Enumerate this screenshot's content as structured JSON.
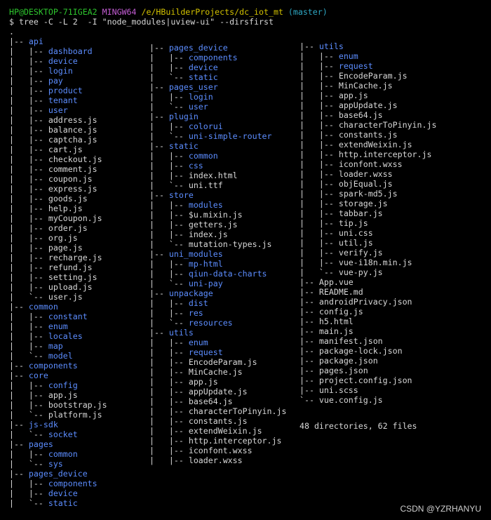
{
  "prompt": {
    "user_host": "HP@DESKTOP-71IGEA2",
    "system": "MINGW64",
    "path": "/e/HBuilderProjects/dc_iot_mt",
    "branch": "(master)"
  },
  "command": "$ tree -C -L 2  -I \"node_modules|uview-ui\" --dirsfirst",
  "columns": [
    [
      {
        "p": ".",
        "n": "",
        "t": "dir"
      },
      {
        "p": "|-- ",
        "n": "api",
        "t": "dir"
      },
      {
        "p": "|   |-- ",
        "n": "dashboard",
        "t": "dir"
      },
      {
        "p": "|   |-- ",
        "n": "device",
        "t": "dir"
      },
      {
        "p": "|   |-- ",
        "n": "login",
        "t": "dir"
      },
      {
        "p": "|   |-- ",
        "n": "pay",
        "t": "dir"
      },
      {
        "p": "|   |-- ",
        "n": "product",
        "t": "dir"
      },
      {
        "p": "|   |-- ",
        "n": "tenant",
        "t": "dir"
      },
      {
        "p": "|   |-- ",
        "n": "user",
        "t": "dir"
      },
      {
        "p": "|   |-- ",
        "n": "address.js",
        "t": "file"
      },
      {
        "p": "|   |-- ",
        "n": "balance.js",
        "t": "file"
      },
      {
        "p": "|   |-- ",
        "n": "captcha.js",
        "t": "file"
      },
      {
        "p": "|   |-- ",
        "n": "cart.js",
        "t": "file"
      },
      {
        "p": "|   |-- ",
        "n": "checkout.js",
        "t": "file"
      },
      {
        "p": "|   |-- ",
        "n": "comment.js",
        "t": "file"
      },
      {
        "p": "|   |-- ",
        "n": "coupon.js",
        "t": "file"
      },
      {
        "p": "|   |-- ",
        "n": "express.js",
        "t": "file"
      },
      {
        "p": "|   |-- ",
        "n": "goods.js",
        "t": "file"
      },
      {
        "p": "|   |-- ",
        "n": "help.js",
        "t": "file"
      },
      {
        "p": "|   |-- ",
        "n": "myCoupon.js",
        "t": "file"
      },
      {
        "p": "|   |-- ",
        "n": "order.js",
        "t": "file"
      },
      {
        "p": "|   |-- ",
        "n": "org.js",
        "t": "file"
      },
      {
        "p": "|   |-- ",
        "n": "page.js",
        "t": "file"
      },
      {
        "p": "|   |-- ",
        "n": "recharge.js",
        "t": "file"
      },
      {
        "p": "|   |-- ",
        "n": "refund.js",
        "t": "file"
      },
      {
        "p": "|   |-- ",
        "n": "setting.js",
        "t": "file"
      },
      {
        "p": "|   |-- ",
        "n": "upload.js",
        "t": "file"
      },
      {
        "p": "|   `-- ",
        "n": "user.js",
        "t": "file"
      },
      {
        "p": "|-- ",
        "n": "common",
        "t": "dir"
      },
      {
        "p": "|   |-- ",
        "n": "constant",
        "t": "dir"
      },
      {
        "p": "|   |-- ",
        "n": "enum",
        "t": "dir"
      },
      {
        "p": "|   |-- ",
        "n": "locales",
        "t": "dir"
      },
      {
        "p": "|   |-- ",
        "n": "map",
        "t": "dir"
      },
      {
        "p": "|   `-- ",
        "n": "model",
        "t": "dir"
      },
      {
        "p": "|-- ",
        "n": "components",
        "t": "dir"
      },
      {
        "p": "|-- ",
        "n": "core",
        "t": "dir"
      },
      {
        "p": "|   |-- ",
        "n": "config",
        "t": "dir"
      },
      {
        "p": "|   |-- ",
        "n": "app.js",
        "t": "file"
      },
      {
        "p": "|   |-- ",
        "n": "bootstrap.js",
        "t": "file"
      },
      {
        "p": "|   `-- ",
        "n": "platform.js",
        "t": "file"
      },
      {
        "p": "|-- ",
        "n": "js-sdk",
        "t": "dir"
      },
      {
        "p": "|   `-- ",
        "n": "socket",
        "t": "dir"
      },
      {
        "p": "|-- ",
        "n": "pages",
        "t": "dir"
      },
      {
        "p": "|   |-- ",
        "n": "common",
        "t": "dir"
      },
      {
        "p": "|   `-- ",
        "n": "sys",
        "t": "dir"
      },
      {
        "p": "|-- ",
        "n": "pages_device",
        "t": "dir"
      },
      {
        "p": "|   |-- ",
        "n": "components",
        "t": "dir"
      },
      {
        "p": "|   |-- ",
        "n": "device",
        "t": "dir"
      },
      {
        "p": "|   `-- ",
        "n": "static",
        "t": "dir"
      }
    ],
    [
      {
        "p": "|-- ",
        "n": "pages_device",
        "t": "dir"
      },
      {
        "p": "|   |-- ",
        "n": "components",
        "t": "dir"
      },
      {
        "p": "|   |-- ",
        "n": "device",
        "t": "dir"
      },
      {
        "p": "|   `-- ",
        "n": "static",
        "t": "dir"
      },
      {
        "p": "|-- ",
        "n": "pages_user",
        "t": "dir"
      },
      {
        "p": "|   |-- ",
        "n": "login",
        "t": "dir"
      },
      {
        "p": "|   `-- ",
        "n": "user",
        "t": "dir"
      },
      {
        "p": "|-- ",
        "n": "plugin",
        "t": "dir"
      },
      {
        "p": "|   |-- ",
        "n": "colorui",
        "t": "dir"
      },
      {
        "p": "|   `-- ",
        "n": "uni-simple-router",
        "t": "dir"
      },
      {
        "p": "|-- ",
        "n": "static",
        "t": "dir"
      },
      {
        "p": "|   |-- ",
        "n": "common",
        "t": "dir"
      },
      {
        "p": "|   |-- ",
        "n": "css",
        "t": "dir"
      },
      {
        "p": "|   |-- ",
        "n": "index.html",
        "t": "file"
      },
      {
        "p": "|   `-- ",
        "n": "uni.ttf",
        "t": "file"
      },
      {
        "p": "|-- ",
        "n": "store",
        "t": "dir"
      },
      {
        "p": "|   |-- ",
        "n": "modules",
        "t": "dir"
      },
      {
        "p": "|   |-- ",
        "n": "$u.mixin.js",
        "t": "file"
      },
      {
        "p": "|   |-- ",
        "n": "getters.js",
        "t": "file"
      },
      {
        "p": "|   |-- ",
        "n": "index.js",
        "t": "file"
      },
      {
        "p": "|   `-- ",
        "n": "mutation-types.js",
        "t": "file"
      },
      {
        "p": "|-- ",
        "n": "uni_modules",
        "t": "dir"
      },
      {
        "p": "|   |-- ",
        "n": "mp-html",
        "t": "dir"
      },
      {
        "p": "|   |-- ",
        "n": "qiun-data-charts",
        "t": "dir"
      },
      {
        "p": "|   `-- ",
        "n": "uni-pay",
        "t": "dir"
      },
      {
        "p": "|-- ",
        "n": "unpackage",
        "t": "dir"
      },
      {
        "p": "|   |-- ",
        "n": "dist",
        "t": "dir"
      },
      {
        "p": "|   |-- ",
        "n": "res",
        "t": "dir"
      },
      {
        "p": "|   `-- ",
        "n": "resources",
        "t": "dir"
      },
      {
        "p": "|-- ",
        "n": "utils",
        "t": "dir"
      },
      {
        "p": "|   |-- ",
        "n": "enum",
        "t": "dir"
      },
      {
        "p": "|   |-- ",
        "n": "request",
        "t": "dir"
      },
      {
        "p": "|   |-- ",
        "n": "EncodeParam.js",
        "t": "file"
      },
      {
        "p": "|   |-- ",
        "n": "MinCache.js",
        "t": "file"
      },
      {
        "p": "|   |-- ",
        "n": "app.js",
        "t": "file"
      },
      {
        "p": "|   |-- ",
        "n": "appUpdate.js",
        "t": "file"
      },
      {
        "p": "|   |-- ",
        "n": "base64.js",
        "t": "file"
      },
      {
        "p": "|   |-- ",
        "n": "characterToPinyin.js",
        "t": "file"
      },
      {
        "p": "|   |-- ",
        "n": "constants.js",
        "t": "file"
      },
      {
        "p": "|   |-- ",
        "n": "extendWeixin.js",
        "t": "file"
      },
      {
        "p": "|   |-- ",
        "n": "http.interceptor.js",
        "t": "file"
      },
      {
        "p": "|   |-- ",
        "n": "iconfont.wxss",
        "t": "file"
      },
      {
        "p": "|   |-- ",
        "n": "loader.wxss",
        "t": "file"
      }
    ],
    [
      {
        "p": "|-- ",
        "n": "utils",
        "t": "dir"
      },
      {
        "p": "|   |-- ",
        "n": "enum",
        "t": "dir"
      },
      {
        "p": "|   |-- ",
        "n": "request",
        "t": "dir"
      },
      {
        "p": "|   |-- ",
        "n": "EncodeParam.js",
        "t": "file"
      },
      {
        "p": "|   |-- ",
        "n": "MinCache.js",
        "t": "file"
      },
      {
        "p": "|   |-- ",
        "n": "app.js",
        "t": "file"
      },
      {
        "p": "|   |-- ",
        "n": "appUpdate.js",
        "t": "file"
      },
      {
        "p": "|   |-- ",
        "n": "base64.js",
        "t": "file"
      },
      {
        "p": "|   |-- ",
        "n": "characterToPinyin.js",
        "t": "file"
      },
      {
        "p": "|   |-- ",
        "n": "constants.js",
        "t": "file"
      },
      {
        "p": "|   |-- ",
        "n": "extendWeixin.js",
        "t": "file"
      },
      {
        "p": "|   |-- ",
        "n": "http.interceptor.js",
        "t": "file"
      },
      {
        "p": "|   |-- ",
        "n": "iconfont.wxss",
        "t": "file"
      },
      {
        "p": "|   |-- ",
        "n": "loader.wxss",
        "t": "file"
      },
      {
        "p": "|   |-- ",
        "n": "objEqual.js",
        "t": "file"
      },
      {
        "p": "|   |-- ",
        "n": "spark-md5.js",
        "t": "file"
      },
      {
        "p": "|   |-- ",
        "n": "storage.js",
        "t": "file"
      },
      {
        "p": "|   |-- ",
        "n": "tabbar.js",
        "t": "file"
      },
      {
        "p": "|   |-- ",
        "n": "tip.js",
        "t": "file"
      },
      {
        "p": "|   |-- ",
        "n": "uni.css",
        "t": "file"
      },
      {
        "p": "|   |-- ",
        "n": "util.js",
        "t": "file"
      },
      {
        "p": "|   |-- ",
        "n": "verify.js",
        "t": "file"
      },
      {
        "p": "|   |-- ",
        "n": "vue-i18n.min.js",
        "t": "file"
      },
      {
        "p": "|   `-- ",
        "n": "vue-py.js",
        "t": "file"
      },
      {
        "p": "|-- ",
        "n": "App.vue",
        "t": "file"
      },
      {
        "p": "|-- ",
        "n": "README.md",
        "t": "file"
      },
      {
        "p": "|-- ",
        "n": "androidPrivacy.json",
        "t": "file"
      },
      {
        "p": "|-- ",
        "n": "config.js",
        "t": "file"
      },
      {
        "p": "|-- ",
        "n": "h5.html",
        "t": "file"
      },
      {
        "p": "|-- ",
        "n": "main.js",
        "t": "file"
      },
      {
        "p": "|-- ",
        "n": "manifest.json",
        "t": "file"
      },
      {
        "p": "|-- ",
        "n": "package-lock.json",
        "t": "file"
      },
      {
        "p": "|-- ",
        "n": "package.json",
        "t": "file"
      },
      {
        "p": "|-- ",
        "n": "pages.json",
        "t": "file"
      },
      {
        "p": "|-- ",
        "n": "project.config.json",
        "t": "file"
      },
      {
        "p": "|-- ",
        "n": "uni.scss",
        "t": "file"
      },
      {
        "p": "`-- ",
        "n": "vue.config.js",
        "t": "file"
      }
    ]
  ],
  "summary": "48 directories, 62 files",
  "watermark": "CSDN @YZRHANYU",
  "colors": {
    "background": "#000000",
    "text": "#d8d8d8",
    "directory": "#5c8dff",
    "user_host": "#2ec52e",
    "system": "#c35dd4",
    "path": "#d3c200",
    "branch": "#2ea8c4"
  }
}
